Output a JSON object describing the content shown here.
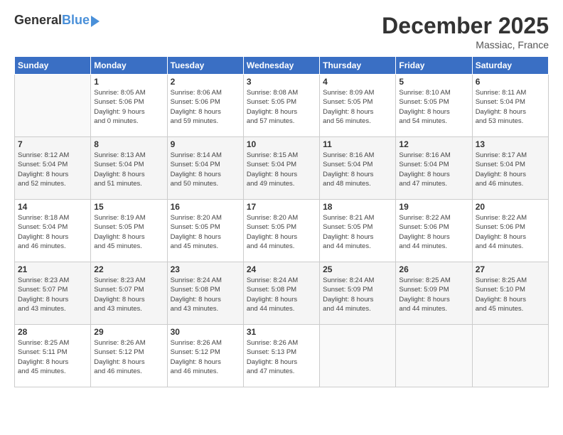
{
  "logo": {
    "general": "General",
    "blue": "Blue"
  },
  "header": {
    "month": "December 2025",
    "location": "Massiac, France"
  },
  "weekdays": [
    "Sunday",
    "Monday",
    "Tuesday",
    "Wednesday",
    "Thursday",
    "Friday",
    "Saturday"
  ],
  "weeks": [
    [
      {
        "day": "",
        "info": ""
      },
      {
        "day": "1",
        "info": "Sunrise: 8:05 AM\nSunset: 5:06 PM\nDaylight: 9 hours\nand 0 minutes."
      },
      {
        "day": "2",
        "info": "Sunrise: 8:06 AM\nSunset: 5:06 PM\nDaylight: 8 hours\nand 59 minutes."
      },
      {
        "day": "3",
        "info": "Sunrise: 8:08 AM\nSunset: 5:05 PM\nDaylight: 8 hours\nand 57 minutes."
      },
      {
        "day": "4",
        "info": "Sunrise: 8:09 AM\nSunset: 5:05 PM\nDaylight: 8 hours\nand 56 minutes."
      },
      {
        "day": "5",
        "info": "Sunrise: 8:10 AM\nSunset: 5:05 PM\nDaylight: 8 hours\nand 54 minutes."
      },
      {
        "day": "6",
        "info": "Sunrise: 8:11 AM\nSunset: 5:04 PM\nDaylight: 8 hours\nand 53 minutes."
      }
    ],
    [
      {
        "day": "7",
        "info": "Sunrise: 8:12 AM\nSunset: 5:04 PM\nDaylight: 8 hours\nand 52 minutes."
      },
      {
        "day": "8",
        "info": "Sunrise: 8:13 AM\nSunset: 5:04 PM\nDaylight: 8 hours\nand 51 minutes."
      },
      {
        "day": "9",
        "info": "Sunrise: 8:14 AM\nSunset: 5:04 PM\nDaylight: 8 hours\nand 50 minutes."
      },
      {
        "day": "10",
        "info": "Sunrise: 8:15 AM\nSunset: 5:04 PM\nDaylight: 8 hours\nand 49 minutes."
      },
      {
        "day": "11",
        "info": "Sunrise: 8:16 AM\nSunset: 5:04 PM\nDaylight: 8 hours\nand 48 minutes."
      },
      {
        "day": "12",
        "info": "Sunrise: 8:16 AM\nSunset: 5:04 PM\nDaylight: 8 hours\nand 47 minutes."
      },
      {
        "day": "13",
        "info": "Sunrise: 8:17 AM\nSunset: 5:04 PM\nDaylight: 8 hours\nand 46 minutes."
      }
    ],
    [
      {
        "day": "14",
        "info": "Sunrise: 8:18 AM\nSunset: 5:04 PM\nDaylight: 8 hours\nand 46 minutes."
      },
      {
        "day": "15",
        "info": "Sunrise: 8:19 AM\nSunset: 5:05 PM\nDaylight: 8 hours\nand 45 minutes."
      },
      {
        "day": "16",
        "info": "Sunrise: 8:20 AM\nSunset: 5:05 PM\nDaylight: 8 hours\nand 45 minutes."
      },
      {
        "day": "17",
        "info": "Sunrise: 8:20 AM\nSunset: 5:05 PM\nDaylight: 8 hours\nand 44 minutes."
      },
      {
        "day": "18",
        "info": "Sunrise: 8:21 AM\nSunset: 5:05 PM\nDaylight: 8 hours\nand 44 minutes."
      },
      {
        "day": "19",
        "info": "Sunrise: 8:22 AM\nSunset: 5:06 PM\nDaylight: 8 hours\nand 44 minutes."
      },
      {
        "day": "20",
        "info": "Sunrise: 8:22 AM\nSunset: 5:06 PM\nDaylight: 8 hours\nand 44 minutes."
      }
    ],
    [
      {
        "day": "21",
        "info": "Sunrise: 8:23 AM\nSunset: 5:07 PM\nDaylight: 8 hours\nand 43 minutes."
      },
      {
        "day": "22",
        "info": "Sunrise: 8:23 AM\nSunset: 5:07 PM\nDaylight: 8 hours\nand 43 minutes."
      },
      {
        "day": "23",
        "info": "Sunrise: 8:24 AM\nSunset: 5:08 PM\nDaylight: 8 hours\nand 43 minutes."
      },
      {
        "day": "24",
        "info": "Sunrise: 8:24 AM\nSunset: 5:08 PM\nDaylight: 8 hours\nand 44 minutes."
      },
      {
        "day": "25",
        "info": "Sunrise: 8:24 AM\nSunset: 5:09 PM\nDaylight: 8 hours\nand 44 minutes."
      },
      {
        "day": "26",
        "info": "Sunrise: 8:25 AM\nSunset: 5:09 PM\nDaylight: 8 hours\nand 44 minutes."
      },
      {
        "day": "27",
        "info": "Sunrise: 8:25 AM\nSunset: 5:10 PM\nDaylight: 8 hours\nand 45 minutes."
      }
    ],
    [
      {
        "day": "28",
        "info": "Sunrise: 8:25 AM\nSunset: 5:11 PM\nDaylight: 8 hours\nand 45 minutes."
      },
      {
        "day": "29",
        "info": "Sunrise: 8:26 AM\nSunset: 5:12 PM\nDaylight: 8 hours\nand 46 minutes."
      },
      {
        "day": "30",
        "info": "Sunrise: 8:26 AM\nSunset: 5:12 PM\nDaylight: 8 hours\nand 46 minutes."
      },
      {
        "day": "31",
        "info": "Sunrise: 8:26 AM\nSunset: 5:13 PM\nDaylight: 8 hours\nand 47 minutes."
      },
      {
        "day": "",
        "info": ""
      },
      {
        "day": "",
        "info": ""
      },
      {
        "day": "",
        "info": ""
      }
    ]
  ]
}
